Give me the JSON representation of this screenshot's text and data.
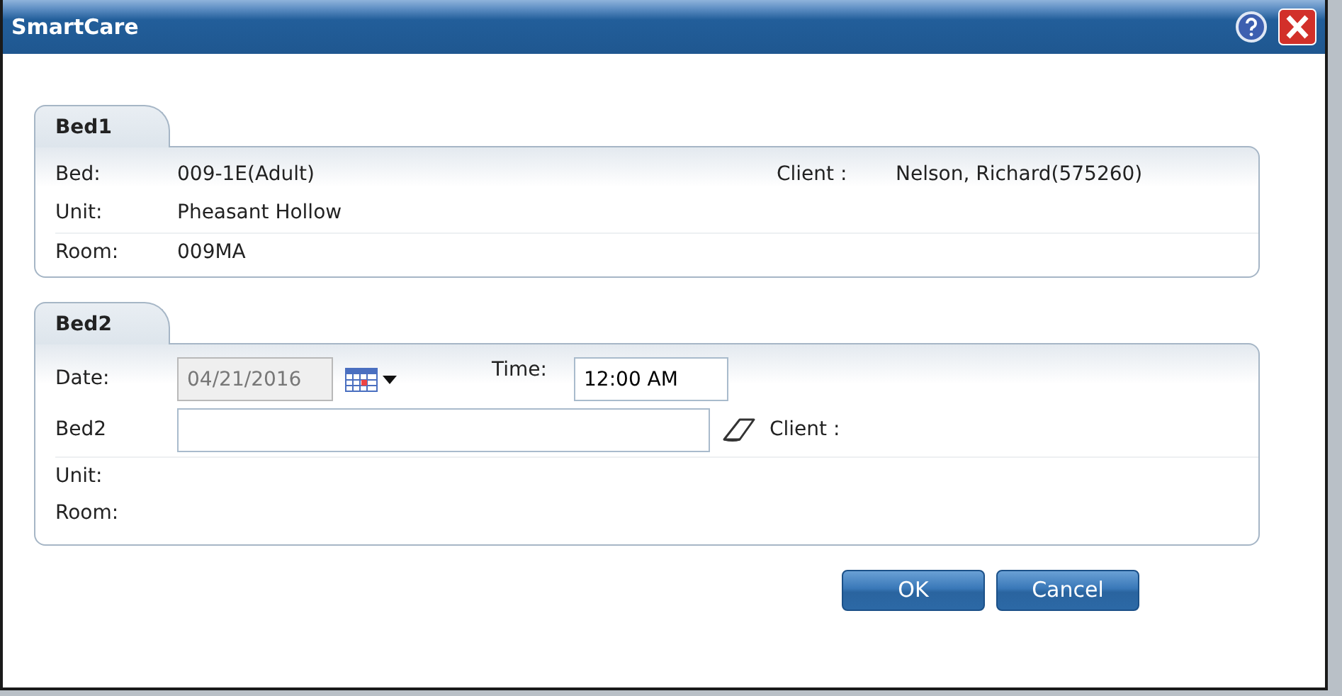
{
  "window": {
    "title": "SmartCare"
  },
  "bed1": {
    "tab": "Bed1",
    "rows": [
      {
        "label": "Bed:",
        "value": "009-1E(Adult)"
      },
      {
        "label": "Unit:",
        "value": "Pheasant Hollow"
      },
      {
        "label": "Room:",
        "value": "009MA"
      }
    ],
    "client": {
      "label": "Client :",
      "value": "Nelson, Richard(575260)"
    }
  },
  "bed2": {
    "tab": "Bed2",
    "date": {
      "label": "Date:",
      "value": "04/21/2016",
      "disabled": true
    },
    "time": {
      "label": "Time:",
      "value": "12:00 AM"
    },
    "bed": {
      "label": "Bed2"
    },
    "client": {
      "label": "Client :"
    },
    "unit": {
      "label": "Unit:"
    },
    "room": {
      "label": "Room:"
    }
  },
  "buttons": [
    "OK",
    "Cancel"
  ]
}
